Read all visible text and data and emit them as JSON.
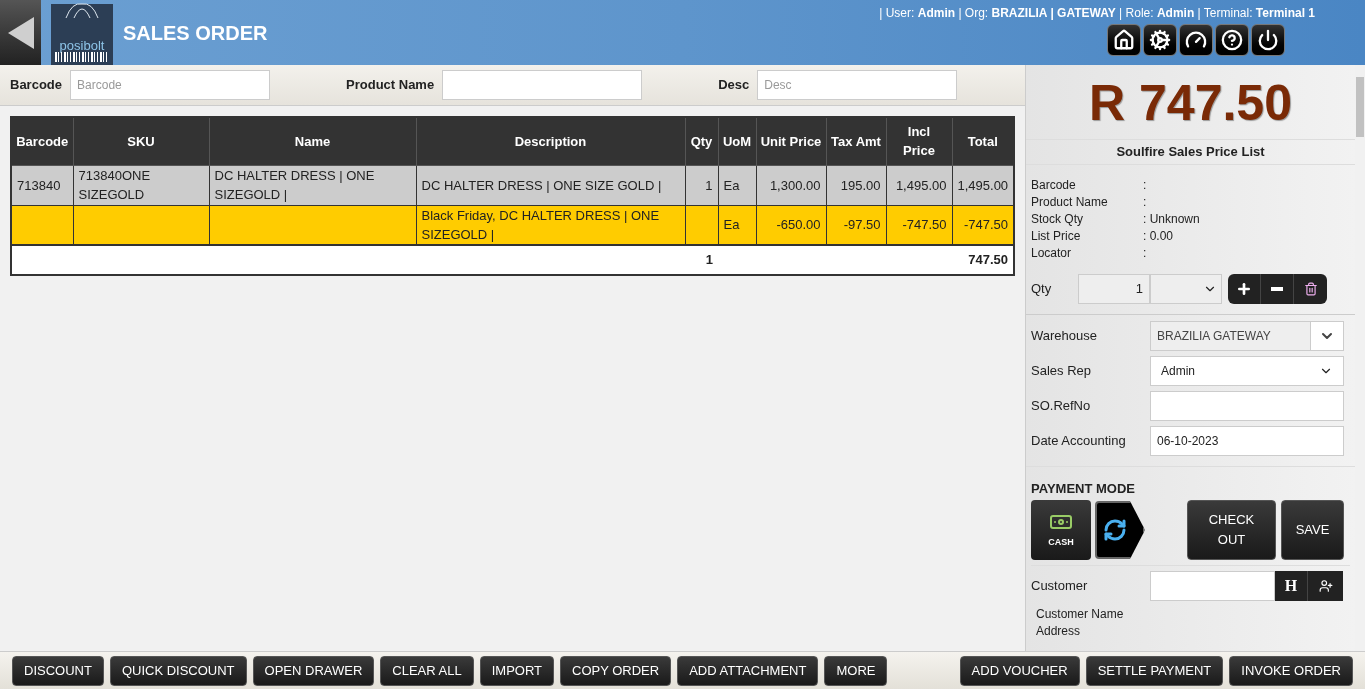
{
  "header": {
    "title": "SALES ORDER",
    "logo": "posibolt",
    "session": "| User: **Admin** | Org: **BRAZILIA | GATEWAY** | Role: **Admin** | Terminal: **Terminal 1**"
  },
  "search": [
    {
      "label": "Barcode",
      "placeholder": "Barcode"
    },
    {
      "label": "Product Name"
    },
    {
      "label": "Desc",
      "placeholder": "Desc"
    }
  ],
  "table": {
    "columns": [
      "Barcode",
      "SKU",
      "Name",
      "Description",
      "Qty",
      "UoM",
      "Unit Price",
      "Tax Amt",
      "Incl Price",
      "Total"
    ],
    "rows": [
      {
        "kind": "product",
        "cells": [
          "713840",
          "713840ONE SIZEGOLD",
          "DC HALTER DRESS | ONE SIZEGOLD |",
          "DC HALTER DRESS | ONE SIZE GOLD |",
          "1",
          "Ea",
          "1,300.00",
          "195.00",
          "1,495.00",
          "1,495.00"
        ]
      },
      {
        "kind": "discount",
        "cells": [
          "",
          "",
          "",
          "Black Friday, DC HALTER DRESS | ONE SIZEGOLD |",
          "",
          "Ea",
          "-650.00",
          "-97.50",
          "-747.50",
          "-747.50"
        ]
      }
    ],
    "totals": {
      "qty": "1",
      "total": "747.50"
    }
  },
  "panel": {
    "amount": "R 747.50",
    "price_list": "Soulfire Sales Price List",
    "info": [
      {
        "label": "Barcode",
        "value": ":"
      },
      {
        "label": "Product Name",
        "value": ":"
      },
      {
        "label": "Stock Qty",
        "value": ": Unknown"
      },
      {
        "label": "List Price",
        "value": ": 0.00"
      },
      {
        "label": "Locator",
        "value": ":"
      }
    ],
    "qty": {
      "label": "Qty",
      "value": "1"
    },
    "form": [
      {
        "kind": "dropdown",
        "label": "Warehouse",
        "value": "BRAZILIA GATEWAY"
      },
      {
        "kind": "select",
        "label": "Sales Rep",
        "value": "Admin"
      },
      {
        "kind": "input",
        "label": "SO.RefNo"
      },
      {
        "kind": "input",
        "label": "Date Accounting",
        "value": "06-10-2023"
      }
    ],
    "payment": {
      "title": "PAYMENT MODE",
      "cash": "CASH",
      "buttons": [
        "CHECK OUT",
        "SAVE"
      ]
    },
    "customer": {
      "label": "Customer",
      "lookup": "H",
      "details": [
        "Customer Name",
        "Address"
      ]
    }
  },
  "footer": {
    "left": [
      "DISCOUNT",
      "QUICK DISCOUNT",
      "OPEN DRAWER",
      "CLEAR ALL",
      "IMPORT",
      "COPY ORDER",
      "ADD ATTACHMENT",
      "MORE"
    ],
    "right": [
      "ADD VOUCHER",
      "SETTLE PAYMENT",
      "INVOKE ORDER"
    ]
  }
}
